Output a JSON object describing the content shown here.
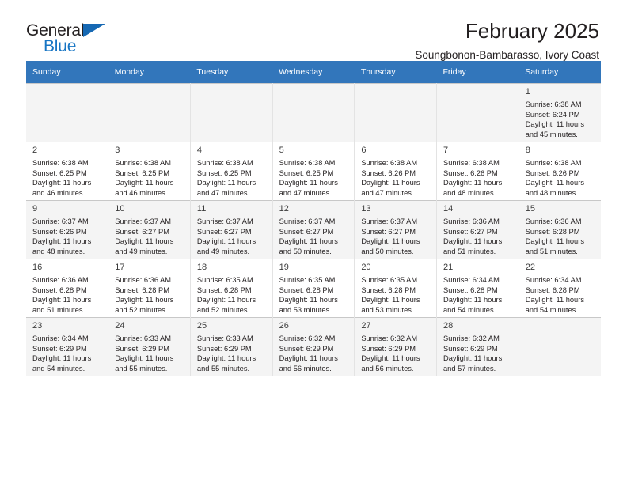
{
  "brand": {
    "name_part1": "General",
    "name_part2": "Blue",
    "triangle_color": "#1668b3",
    "blue_color": "#1775c4"
  },
  "header": {
    "title": "February 2025",
    "subtitle": "Soungbonon-Bambarasso, Ivory Coast"
  },
  "theme": {
    "header_row_bg": "#3276bb",
    "shaded_row_bg": "#f4f4f4",
    "text_color": "#231f20"
  },
  "weekdays": [
    "Sunday",
    "Monday",
    "Tuesday",
    "Wednesday",
    "Thursday",
    "Friday",
    "Saturday"
  ],
  "weeks": [
    [
      {
        "day": "",
        "sunrise": "",
        "sunset": "",
        "daylight1": "",
        "daylight2": ""
      },
      {
        "day": "",
        "sunrise": "",
        "sunset": "",
        "daylight1": "",
        "daylight2": ""
      },
      {
        "day": "",
        "sunrise": "",
        "sunset": "",
        "daylight1": "",
        "daylight2": ""
      },
      {
        "day": "",
        "sunrise": "",
        "sunset": "",
        "daylight1": "",
        "daylight2": ""
      },
      {
        "day": "",
        "sunrise": "",
        "sunset": "",
        "daylight1": "",
        "daylight2": ""
      },
      {
        "day": "",
        "sunrise": "",
        "sunset": "",
        "daylight1": "",
        "daylight2": ""
      },
      {
        "day": "1",
        "sunrise": "Sunrise: 6:38 AM",
        "sunset": "Sunset: 6:24 PM",
        "daylight1": "Daylight: 11 hours",
        "daylight2": "and 45 minutes."
      }
    ],
    [
      {
        "day": "2",
        "sunrise": "Sunrise: 6:38 AM",
        "sunset": "Sunset: 6:25 PM",
        "daylight1": "Daylight: 11 hours",
        "daylight2": "and 46 minutes."
      },
      {
        "day": "3",
        "sunrise": "Sunrise: 6:38 AM",
        "sunset": "Sunset: 6:25 PM",
        "daylight1": "Daylight: 11 hours",
        "daylight2": "and 46 minutes."
      },
      {
        "day": "4",
        "sunrise": "Sunrise: 6:38 AM",
        "sunset": "Sunset: 6:25 PM",
        "daylight1": "Daylight: 11 hours",
        "daylight2": "and 47 minutes."
      },
      {
        "day": "5",
        "sunrise": "Sunrise: 6:38 AM",
        "sunset": "Sunset: 6:25 PM",
        "daylight1": "Daylight: 11 hours",
        "daylight2": "and 47 minutes."
      },
      {
        "day": "6",
        "sunrise": "Sunrise: 6:38 AM",
        "sunset": "Sunset: 6:26 PM",
        "daylight1": "Daylight: 11 hours",
        "daylight2": "and 47 minutes."
      },
      {
        "day": "7",
        "sunrise": "Sunrise: 6:38 AM",
        "sunset": "Sunset: 6:26 PM",
        "daylight1": "Daylight: 11 hours",
        "daylight2": "and 48 minutes."
      },
      {
        "day": "8",
        "sunrise": "Sunrise: 6:38 AM",
        "sunset": "Sunset: 6:26 PM",
        "daylight1": "Daylight: 11 hours",
        "daylight2": "and 48 minutes."
      }
    ],
    [
      {
        "day": "9",
        "sunrise": "Sunrise: 6:37 AM",
        "sunset": "Sunset: 6:26 PM",
        "daylight1": "Daylight: 11 hours",
        "daylight2": "and 48 minutes."
      },
      {
        "day": "10",
        "sunrise": "Sunrise: 6:37 AM",
        "sunset": "Sunset: 6:27 PM",
        "daylight1": "Daylight: 11 hours",
        "daylight2": "and 49 minutes."
      },
      {
        "day": "11",
        "sunrise": "Sunrise: 6:37 AM",
        "sunset": "Sunset: 6:27 PM",
        "daylight1": "Daylight: 11 hours",
        "daylight2": "and 49 minutes."
      },
      {
        "day": "12",
        "sunrise": "Sunrise: 6:37 AM",
        "sunset": "Sunset: 6:27 PM",
        "daylight1": "Daylight: 11 hours",
        "daylight2": "and 50 minutes."
      },
      {
        "day": "13",
        "sunrise": "Sunrise: 6:37 AM",
        "sunset": "Sunset: 6:27 PM",
        "daylight1": "Daylight: 11 hours",
        "daylight2": "and 50 minutes."
      },
      {
        "day": "14",
        "sunrise": "Sunrise: 6:36 AM",
        "sunset": "Sunset: 6:27 PM",
        "daylight1": "Daylight: 11 hours",
        "daylight2": "and 51 minutes."
      },
      {
        "day": "15",
        "sunrise": "Sunrise: 6:36 AM",
        "sunset": "Sunset: 6:28 PM",
        "daylight1": "Daylight: 11 hours",
        "daylight2": "and 51 minutes."
      }
    ],
    [
      {
        "day": "16",
        "sunrise": "Sunrise: 6:36 AM",
        "sunset": "Sunset: 6:28 PM",
        "daylight1": "Daylight: 11 hours",
        "daylight2": "and 51 minutes."
      },
      {
        "day": "17",
        "sunrise": "Sunrise: 6:36 AM",
        "sunset": "Sunset: 6:28 PM",
        "daylight1": "Daylight: 11 hours",
        "daylight2": "and 52 minutes."
      },
      {
        "day": "18",
        "sunrise": "Sunrise: 6:35 AM",
        "sunset": "Sunset: 6:28 PM",
        "daylight1": "Daylight: 11 hours",
        "daylight2": "and 52 minutes."
      },
      {
        "day": "19",
        "sunrise": "Sunrise: 6:35 AM",
        "sunset": "Sunset: 6:28 PM",
        "daylight1": "Daylight: 11 hours",
        "daylight2": "and 53 minutes."
      },
      {
        "day": "20",
        "sunrise": "Sunrise: 6:35 AM",
        "sunset": "Sunset: 6:28 PM",
        "daylight1": "Daylight: 11 hours",
        "daylight2": "and 53 minutes."
      },
      {
        "day": "21",
        "sunrise": "Sunrise: 6:34 AM",
        "sunset": "Sunset: 6:28 PM",
        "daylight1": "Daylight: 11 hours",
        "daylight2": "and 54 minutes."
      },
      {
        "day": "22",
        "sunrise": "Sunrise: 6:34 AM",
        "sunset": "Sunset: 6:28 PM",
        "daylight1": "Daylight: 11 hours",
        "daylight2": "and 54 minutes."
      }
    ],
    [
      {
        "day": "23",
        "sunrise": "Sunrise: 6:34 AM",
        "sunset": "Sunset: 6:29 PM",
        "daylight1": "Daylight: 11 hours",
        "daylight2": "and 54 minutes."
      },
      {
        "day": "24",
        "sunrise": "Sunrise: 6:33 AM",
        "sunset": "Sunset: 6:29 PM",
        "daylight1": "Daylight: 11 hours",
        "daylight2": "and 55 minutes."
      },
      {
        "day": "25",
        "sunrise": "Sunrise: 6:33 AM",
        "sunset": "Sunset: 6:29 PM",
        "daylight1": "Daylight: 11 hours",
        "daylight2": "and 55 minutes."
      },
      {
        "day": "26",
        "sunrise": "Sunrise: 6:32 AM",
        "sunset": "Sunset: 6:29 PM",
        "daylight1": "Daylight: 11 hours",
        "daylight2": "and 56 minutes."
      },
      {
        "day": "27",
        "sunrise": "Sunrise: 6:32 AM",
        "sunset": "Sunset: 6:29 PM",
        "daylight1": "Daylight: 11 hours",
        "daylight2": "and 56 minutes."
      },
      {
        "day": "28",
        "sunrise": "Sunrise: 6:32 AM",
        "sunset": "Sunset: 6:29 PM",
        "daylight1": "Daylight: 11 hours",
        "daylight2": "and 57 minutes."
      },
      {
        "day": "",
        "sunrise": "",
        "sunset": "",
        "daylight1": "",
        "daylight2": ""
      }
    ]
  ]
}
